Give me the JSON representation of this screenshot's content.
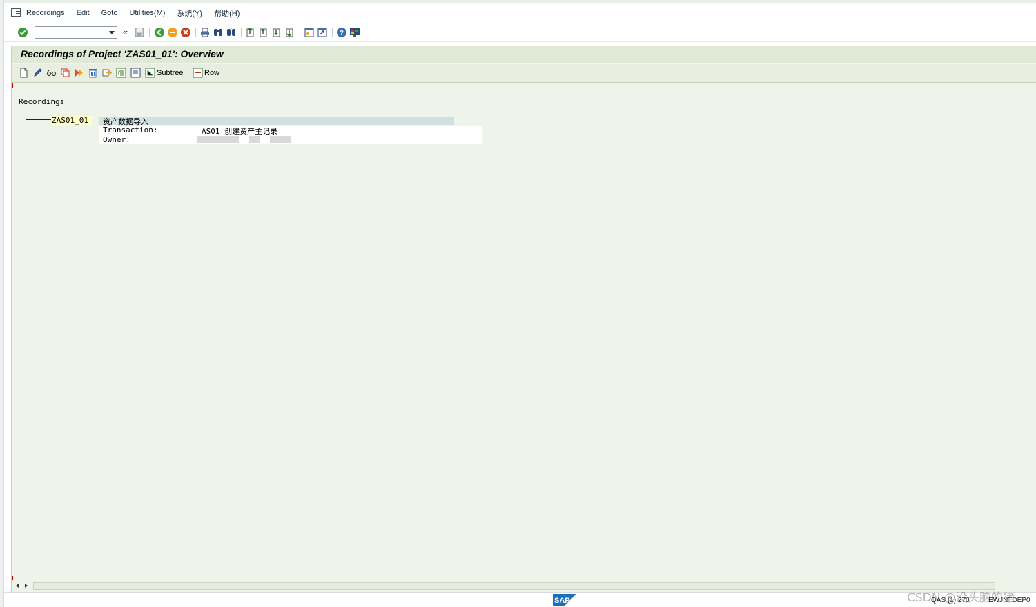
{
  "menubar": {
    "items": [
      "Recordings",
      "Edit",
      "Goto",
      "Utilities(M)",
      "系统(Y)",
      "帮助(H)"
    ]
  },
  "toolbar": {
    "command_field_value": "",
    "nav_back_label": "«"
  },
  "screen": {
    "title": "Recordings of Project 'ZAS01_01': Overview"
  },
  "app_toolbar": {
    "subtree_label": "Subtree",
    "row_label": "Row"
  },
  "tree": {
    "root_label": "Recordings",
    "node": {
      "name": "ZAS01_01",
      "description": "资产数据导入",
      "transaction_label": "Transaction:",
      "transaction_value": "AS01 创建资产主记录",
      "owner_label": "Owner:"
    }
  },
  "status": {
    "system": "QAS (1) 270",
    "host": "EWJNTDEP0",
    "watermark": "CSDN @没头脑的猪"
  }
}
